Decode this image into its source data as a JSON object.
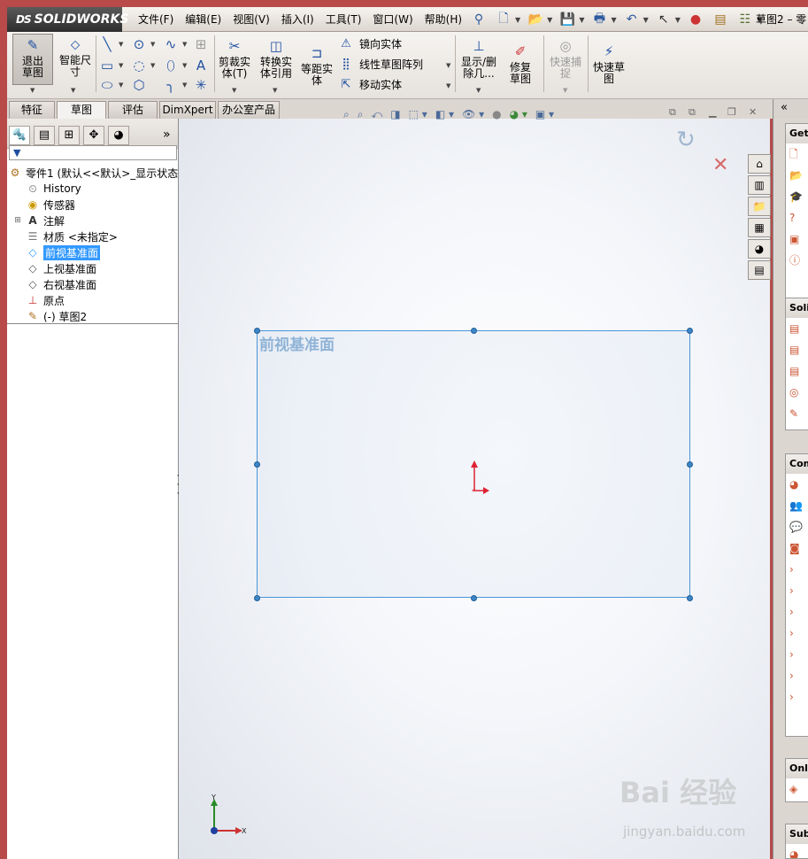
{
  "app": {
    "brand": "SOLIDWORKS",
    "brand_prefix": "DS",
    "doc_title": "草图2 – 零"
  },
  "menu": [
    "文件(F)",
    "编辑(E)",
    "视图(V)",
    "插入(I)",
    "工具(T)",
    "窗口(W)",
    "帮助(H)"
  ],
  "ribbon": {
    "exit_sketch": "退出草图",
    "smart_dim": "智能尺寸",
    "trim": "剪裁实体(T)",
    "convert": "转换实体引用",
    "offset": "等距实体",
    "mirror": "镜向实体",
    "linear_pattern": "线性草图阵列",
    "move": "移动实体",
    "show_delete": "显示/删除几...",
    "repair": "修复草图",
    "quick_snap": "快速捕捉",
    "rapid_sketch": "快速草图"
  },
  "tabs": [
    "特征",
    "草图",
    "评估",
    "DimXpert",
    "办公室产品"
  ],
  "tree": {
    "root": "零件1 (默认<<默认>_显示状态",
    "items": [
      {
        "label": "History",
        "icon": "history-icon"
      },
      {
        "label": "传感器",
        "icon": "sensor-icon"
      },
      {
        "label": "注解",
        "icon": "annotation-icon"
      },
      {
        "label": "材质 <未指定>",
        "icon": "material-icon"
      },
      {
        "label": "前视基准面",
        "icon": "plane-icon"
      },
      {
        "label": "上视基准面",
        "icon": "plane-icon"
      },
      {
        "label": "右视基准面",
        "icon": "plane-icon"
      },
      {
        "label": "原点",
        "icon": "origin-icon"
      },
      {
        "label": "(-) 草图2",
        "icon": "sketch-icon"
      }
    ]
  },
  "viewport": {
    "plane_label": "前视基准面",
    "axis_x": "X",
    "axis_y": "Y"
  },
  "task_pane": {
    "sections": [
      "Gett",
      "Solic",
      "Com",
      "Onli",
      "Subs"
    ],
    "collapse_label": "«"
  },
  "watermark": {
    "main": "Bai 经验",
    "sub": "jingyan.baidu.com"
  },
  "colors": {
    "selection": "#3399ff",
    "plane_border": "#4a95d6",
    "plane_label": "#8fb3d6"
  }
}
